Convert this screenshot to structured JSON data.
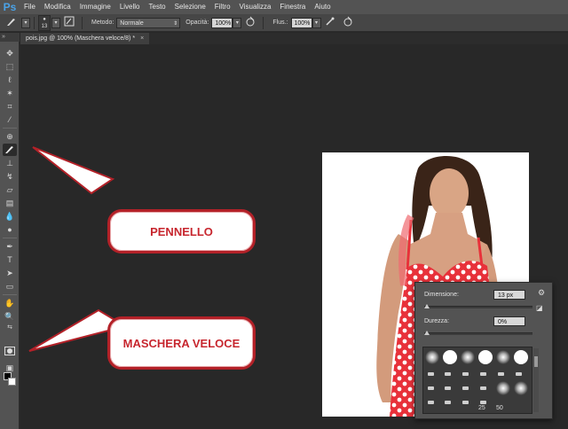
{
  "app": {
    "logo": "Ps"
  },
  "menu": [
    "File",
    "Modifica",
    "Immagine",
    "Livello",
    "Testo",
    "Selezione",
    "Filtro",
    "Visualizza",
    "Finestra",
    "Aiuto"
  ],
  "options_bar": {
    "brush_size": "13",
    "mode_label": "Metodo:",
    "mode_value": "Normale",
    "opacity_label": "Opacità:",
    "opacity_value": "100%",
    "flow_label": "Flus.:",
    "flow_value": "100%"
  },
  "document": {
    "tab_title": "pois.jpg @ 100% (Maschera veloce/8) *",
    "close": "×"
  },
  "callouts": {
    "brush": "PENNELLO",
    "quick_mask": "MASCHERA VELOCE"
  },
  "brush_panel": {
    "size_label": "Dimensione:",
    "size_value": "13 px",
    "hardness_label": "Durezza:",
    "hardness_value": "0%",
    "size_fraction": 0.0,
    "hardness_fraction": 0.0,
    "preset_numbers": [
      "25",
      "50"
    ]
  },
  "colors": {
    "accent_red": "#c7262e",
    "ps_blue": "#4aa3e8",
    "dress_red": "#e8313a"
  }
}
